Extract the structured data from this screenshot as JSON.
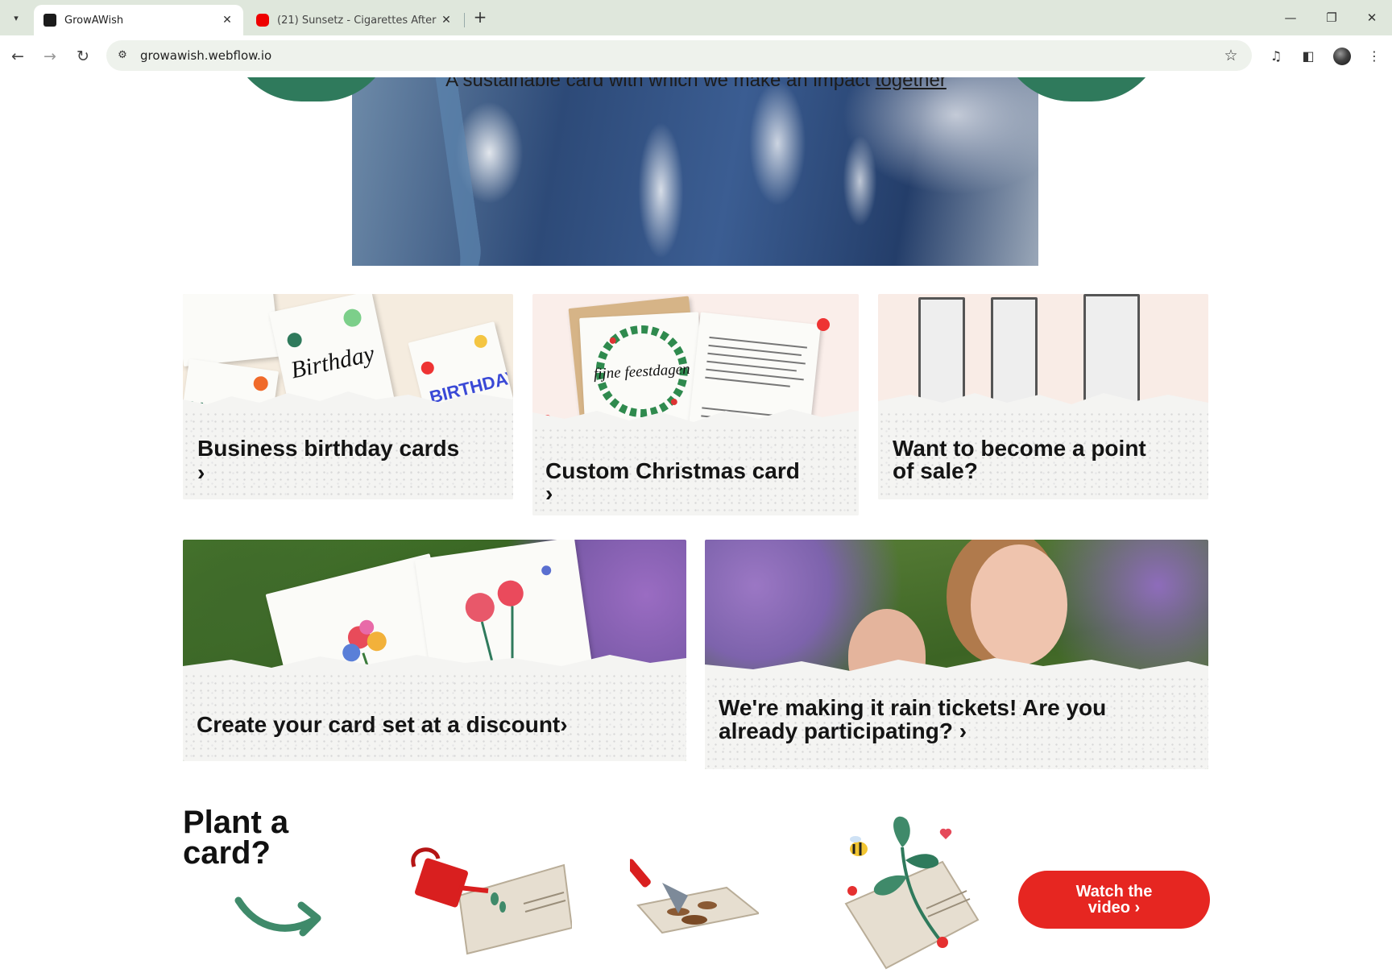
{
  "browser": {
    "tabs": [
      {
        "title": "GrowAWish",
        "active": true
      },
      {
        "title": "(21) Sunsetz - Cigarettes After S",
        "active": false
      }
    ],
    "url": "growawish.webflow.io"
  },
  "hero": {
    "tagline_prefix": "A sustainable card with which we make an impact ",
    "tagline_link": "together"
  },
  "cards": {
    "birthday": {
      "label": "Business birthday cards",
      "arrow": "›"
    },
    "christmas": {
      "label": "Custom Christmas card",
      "arrow": "›",
      "card_text": "fijne feestdagen"
    },
    "point_of_sale": {
      "label_line1": "Want to become a point",
      "label_line2": "of sale?"
    },
    "card_set": {
      "label": "Create your card set at a discount›"
    },
    "tickets": {
      "label_line1": "We're making it rain tickets! Are you",
      "label_line2": "already participating? ›"
    }
  },
  "plant": {
    "title_line1": "Plant a",
    "title_line2": "card?",
    "watch_line1": "Watch the",
    "watch_line2": "video ›"
  },
  "colors": {
    "brand_green": "#2f7a5c",
    "cta_red": "#e62621"
  }
}
